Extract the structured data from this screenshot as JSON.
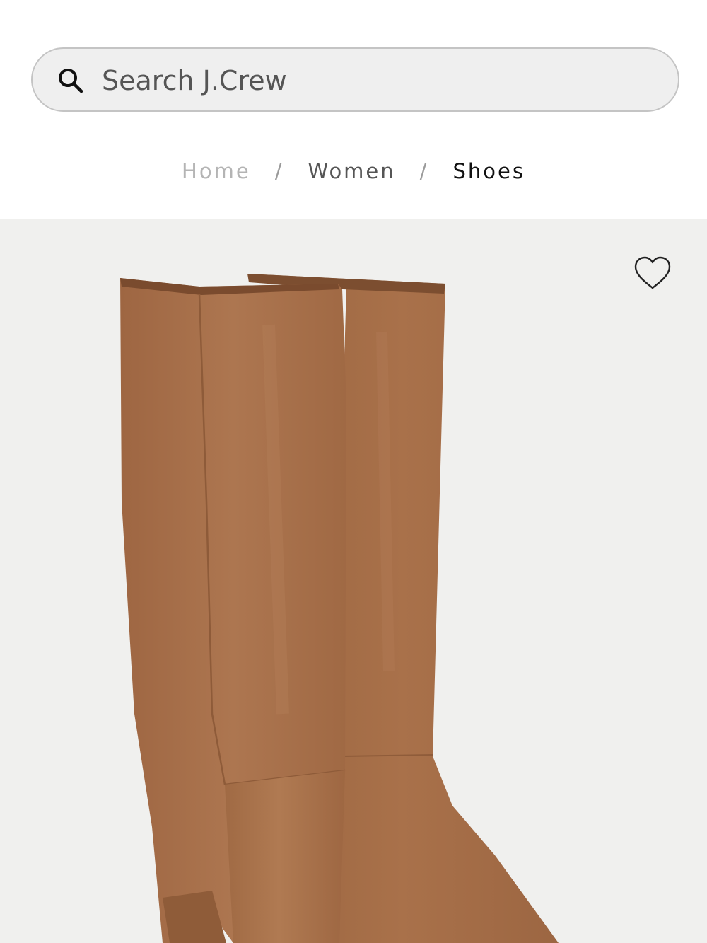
{
  "search": {
    "placeholder": "Search J.Crew",
    "icon": "search-icon"
  },
  "breadcrumb": {
    "items": [
      "Home",
      "Women",
      "Shoes"
    ],
    "separator": "/"
  },
  "product": {
    "image_alt": "Suede knee-high boots",
    "wishlist_icon": "heart-outline-icon",
    "colors": {
      "background": "#f0f0ee",
      "suede": "#a8704a"
    }
  }
}
